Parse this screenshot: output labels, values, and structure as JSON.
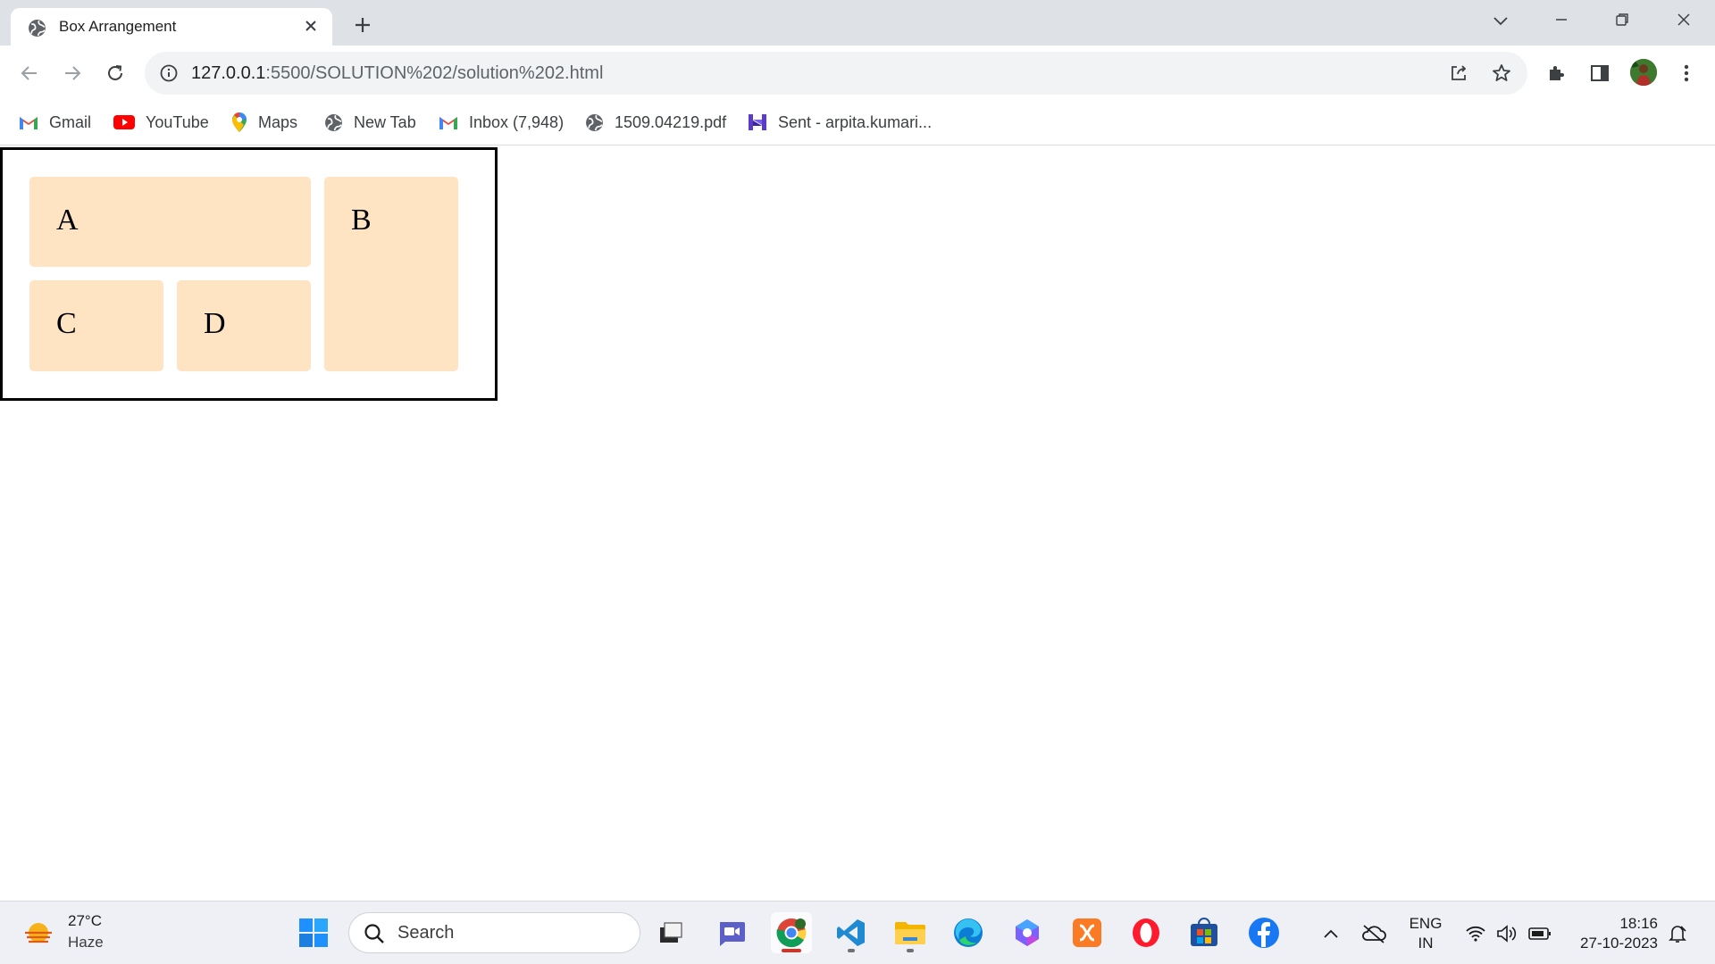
{
  "browser": {
    "tab_title": "Box Arrangement",
    "url_host": "127.0.0.1",
    "url_rest": ":5500/SOLUTION%202/solution%202.html"
  },
  "bookmarks": [
    {
      "label": "Gmail",
      "icon": "gmail-icon"
    },
    {
      "label": "YouTube",
      "icon": "youtube-icon"
    },
    {
      "label": "Maps",
      "icon": "maps-icon"
    },
    {
      "label": "New Tab",
      "icon": "globe-icon"
    },
    {
      "label": "Inbox (7,948)",
      "icon": "gmail-icon"
    },
    {
      "label": "1509.04219.pdf",
      "icon": "globe-icon"
    },
    {
      "label": "Sent - arpita.kumari...",
      "icon": "mail-app-icon"
    }
  ],
  "page": {
    "boxes": {
      "a": "A",
      "b": "B",
      "c": "C",
      "d": "D"
    },
    "box_color": "#ffe4c4",
    "border_color": "#000000"
  },
  "taskbar": {
    "weather_temp": "27°C",
    "weather_cond": "Haze",
    "search_placeholder": "Search",
    "lang_line1": "ENG",
    "lang_line2": "IN",
    "time": "18:16",
    "date": "27-10-2023"
  }
}
